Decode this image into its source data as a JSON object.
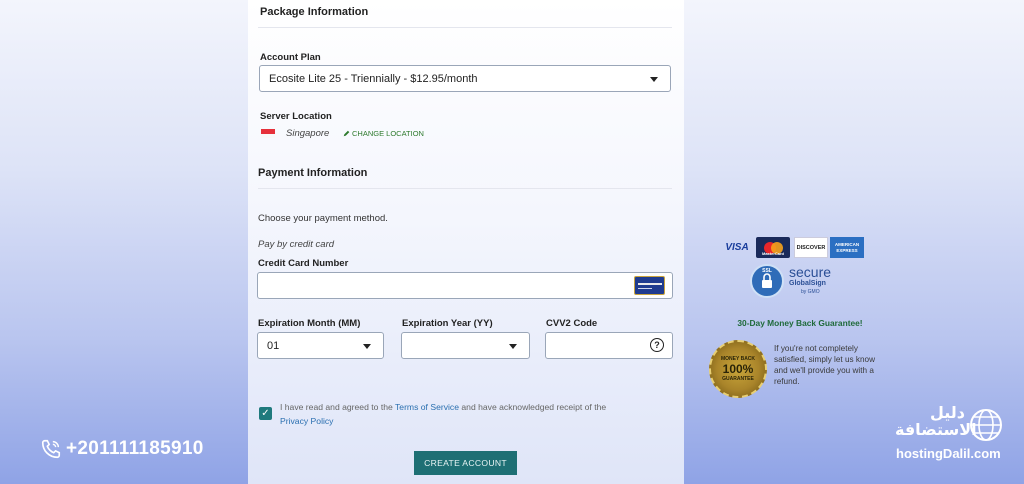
{
  "package": {
    "heading": "Package Information",
    "account_plan_label": "Account Plan",
    "account_plan_value": "Ecosite Lite 25 - Triennially - $12.95/month",
    "server_location_label": "Server Location",
    "server_location_value": "Singapore",
    "change_location_label": "CHANGE LOCATION"
  },
  "payment": {
    "heading": "Payment Information",
    "choose_method": "Choose your payment method.",
    "pay_by_card": "Pay by credit card",
    "card_number_label": "Credit Card Number",
    "card_number_value": "",
    "exp_month_label": "Expiration Month (MM)",
    "exp_month_value": "01",
    "exp_year_label": "Expiration Year (YY)",
    "exp_year_value": "",
    "cvv_label": "CVV2 Code",
    "cvv_value": "",
    "terms_prefix": "I have read and agreed to the ",
    "terms_link": "Terms of Service",
    "terms_middle": " and have acknowledged receipt of the",
    "privacy_link": "Privacy Policy",
    "terms_checked": true,
    "create_button": "CREATE ACCOUNT"
  },
  "trust": {
    "card_logos": [
      "VISA",
      "MasterCard",
      "DISCOVER",
      "AMERICAN EXPRESS"
    ],
    "secure_title": "secure",
    "secure_sub": "GlobalSign",
    "secure_by": "by GMO",
    "ssl_tag": "SSL",
    "guarantee_title": "30-Day Money Back Guarantee!",
    "guarantee_text": "If you're not completely satisfied, simply let us know and we'll provide you with a refund.",
    "seal_top": "MONEY BACK",
    "seal_center": "100%",
    "seal_bottom": "GUARANTEE"
  },
  "overlay": {
    "phone": "+201111185910",
    "brand_arabic_line1": "دليل",
    "brand_arabic_line2": "الاستضافة",
    "brand_en": "hostingDalil.com"
  },
  "colors": {
    "accent_teal": "#1e6f74",
    "link_green": "#2d7a2d",
    "link_blue": "#2a6fb0"
  },
  "icons": [
    "dropdown-caret-icon",
    "flag-singapore-icon",
    "pencil-icon",
    "credit-card-icon",
    "help-circle-icon",
    "checkmark-icon",
    "phone-icon",
    "globe-icon",
    "lock-icon"
  ]
}
